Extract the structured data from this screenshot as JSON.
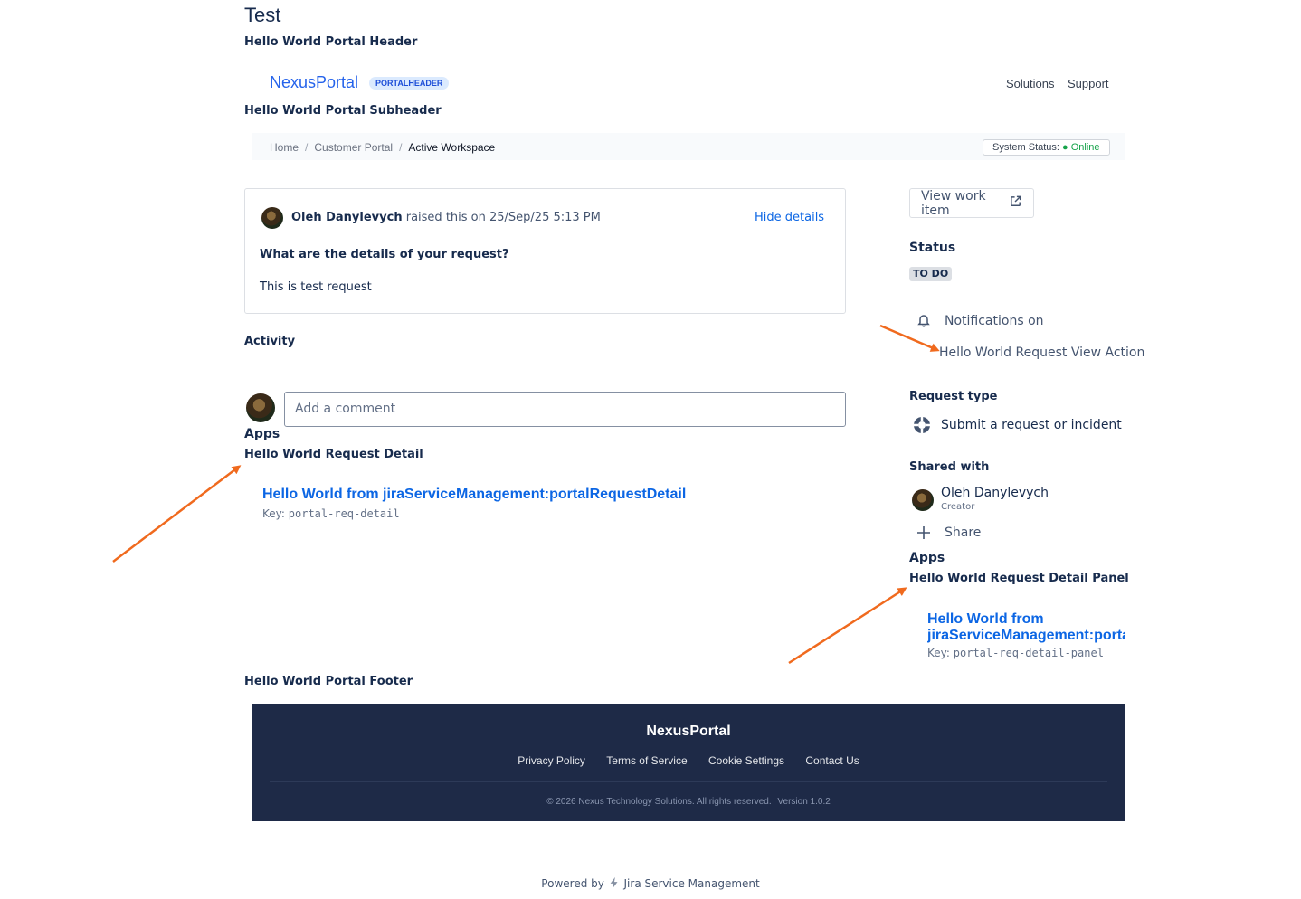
{
  "page": {
    "title": "Test",
    "portal_header": "Hello World Portal Header",
    "portal_subheader": "Hello World Portal Subheader",
    "portal_footer": "Hello World Portal Footer"
  },
  "header": {
    "brand": "NexusPortal",
    "badge": "PORTALHEADER",
    "nav": [
      "Solutions",
      "Support"
    ]
  },
  "breadcrumb": {
    "items": [
      "Home",
      "Customer Portal",
      "Active Workspace"
    ],
    "separator": "/",
    "status_label": "System Status:",
    "status_value": "● Online"
  },
  "request": {
    "author": "Oleh Danylevych",
    "raised_text": "raised this on 25/Sep/25 5:13 PM",
    "hide_details": "Hide details",
    "question": "What are the details of your request?",
    "answer": "This is test request"
  },
  "activity": {
    "heading": "Activity",
    "comment_placeholder": "Add a comment"
  },
  "apps_main": {
    "heading": "Apps",
    "module_title": "Hello World Request Detail",
    "link": "Hello World from jiraServiceManagement:portalRequestDetail",
    "key_label": "Key:",
    "key_value": "portal-req-detail"
  },
  "sidebar": {
    "view_work_item": "View work item",
    "status_heading": "Status",
    "status_value": "TO DO",
    "notifications": "Notifications on",
    "view_action": "Hello World Request View Action",
    "request_type_heading": "Request type",
    "request_type": "Submit a request or incident",
    "shared_heading": "Shared with",
    "shared_name": "Oleh Danylevych",
    "shared_role": "Creator",
    "share": "Share",
    "apps_heading": "Apps",
    "panel_title": "Hello World Request Detail Panel",
    "panel_link_line1": "Hello World from",
    "panel_link_line2": "jiraServiceManagement:porta",
    "key_label": "Key:",
    "key_value": "portal-req-detail-panel"
  },
  "footer": {
    "brand": "NexusPortal",
    "links": [
      "Privacy Policy",
      "Terms of Service",
      "Cookie Settings",
      "Contact Us"
    ],
    "copyright": "© 2026 Nexus Technology Solutions. All rights reserved.",
    "version": "Version 1.0.2"
  },
  "powered_by": {
    "prefix": "Powered by",
    "product": "Jira Service Management"
  },
  "colors": {
    "accent": "#0c66e4",
    "brand": "#2563eb",
    "footer_bg": "#1e2a47",
    "annotation_arrow": "#f06a1e",
    "status_online": "#16a34a"
  }
}
